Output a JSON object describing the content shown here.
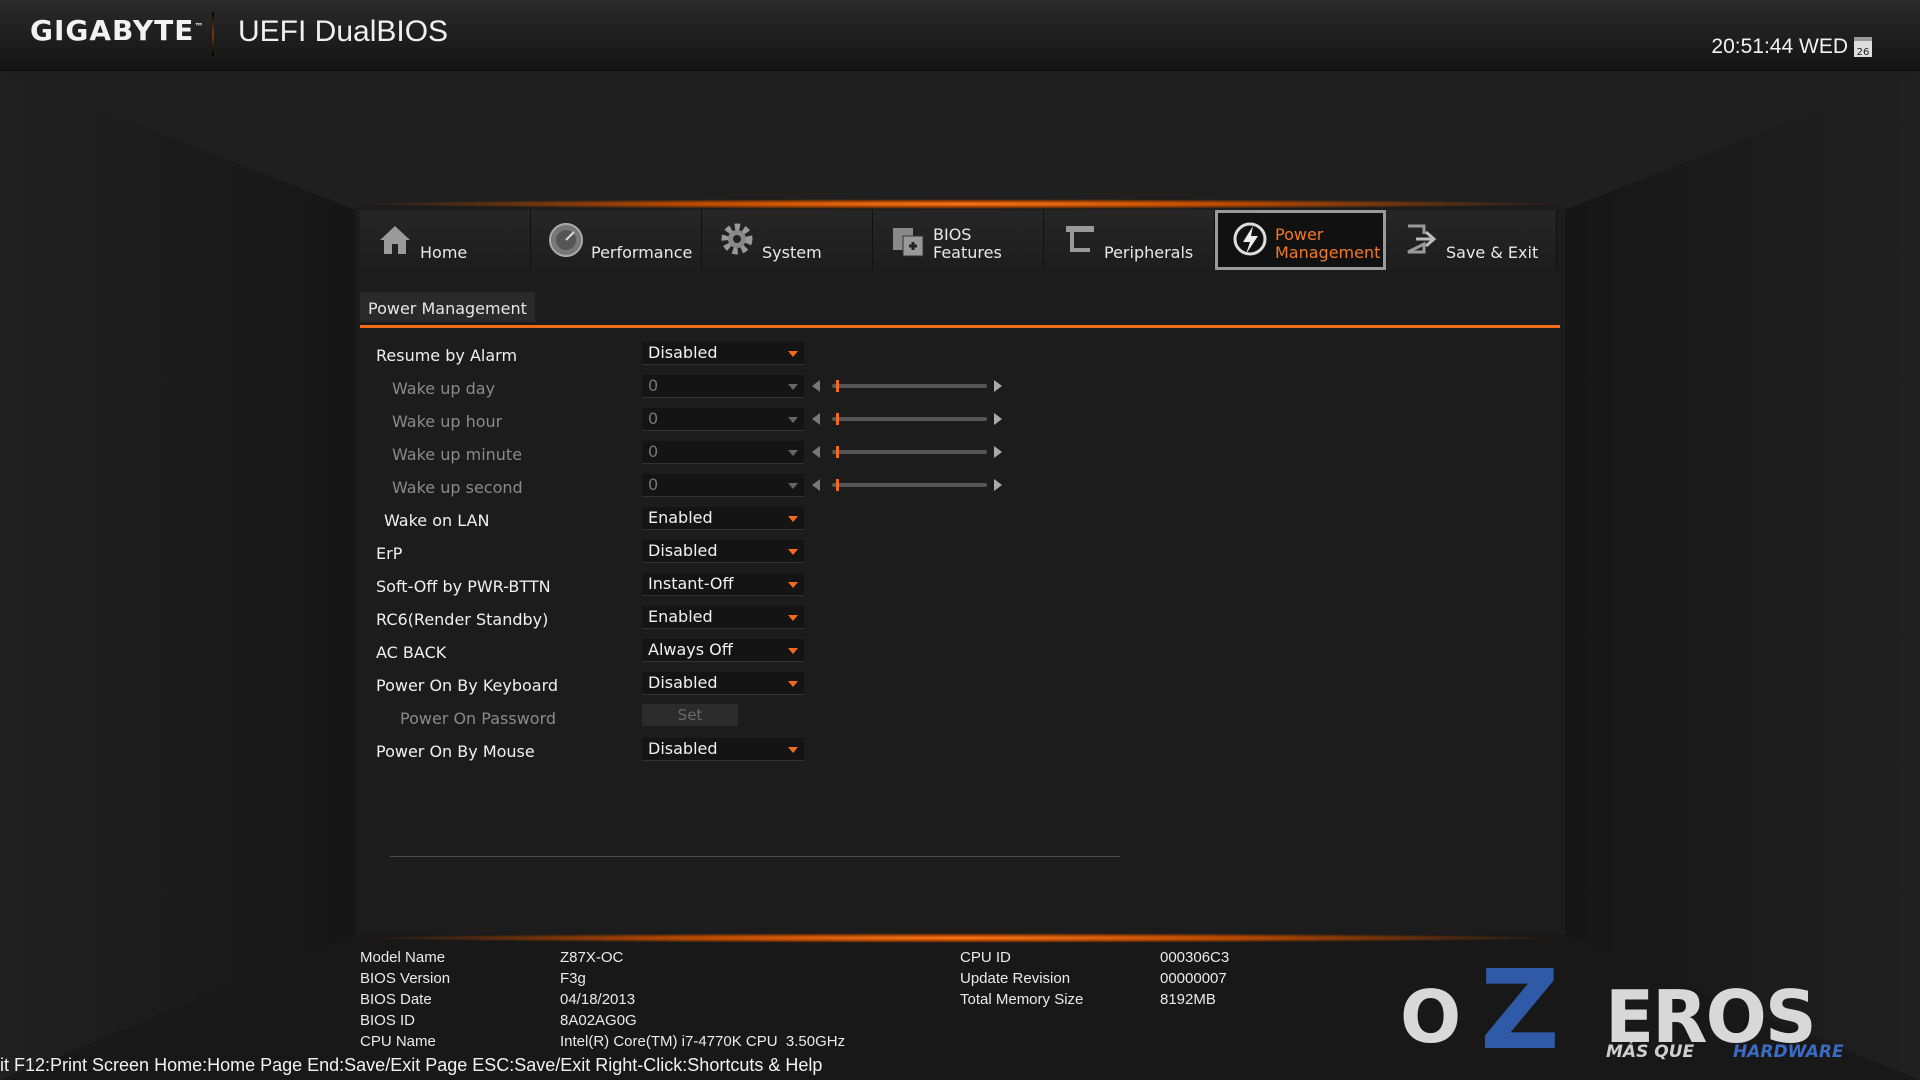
{
  "header": {
    "brand": "GIGABYTE",
    "brand_tm": "™",
    "title": "UEFI DualBIOS",
    "clock": "20:51:44 WED",
    "calendar_day": "26"
  },
  "tabs": [
    {
      "label": "Home",
      "icon": "home-icon"
    },
    {
      "label": "Performance",
      "icon": "speedometer-icon"
    },
    {
      "label": "System",
      "icon": "gear-icon"
    },
    {
      "label": "BIOS\nFeatures",
      "label_line1": "BIOS",
      "label_line2": "Features",
      "icon": "bios-chip-icon"
    },
    {
      "label": "Peripherals",
      "icon": "peripherals-icon"
    },
    {
      "label_line1": "Power",
      "label_line2": "Management",
      "icon": "power-icon",
      "active": true
    },
    {
      "label": "Save & Exit",
      "icon": "exit-icon"
    }
  ],
  "section": {
    "title": "Power Management"
  },
  "settings": [
    {
      "label": "Resume by Alarm",
      "value": "Disabled",
      "dim": false
    },
    {
      "label": "Wake up day",
      "value": "0",
      "dim": true
    },
    {
      "label": "Wake up hour",
      "value": "0",
      "dim": true
    },
    {
      "label": "Wake up minute",
      "value": "0",
      "dim": true
    },
    {
      "label": "Wake up second",
      "value": "0",
      "dim": true
    },
    {
      "label": "Wake on LAN",
      "value": "Enabled",
      "dim": false
    },
    {
      "label": "ErP",
      "value": "Disabled",
      "dim": false
    },
    {
      "label": "Soft-Off by PWR-BTTN",
      "value": "Instant-Off",
      "dim": false
    },
    {
      "label": "RC6(Render Standby)",
      "value": "Enabled",
      "dim": false
    },
    {
      "label": "AC BACK",
      "value": "Always Off",
      "dim": false
    },
    {
      "label": "Power On By Keyboard",
      "value": "Disabled",
      "dim": false
    },
    {
      "label": "Power On Password",
      "button": "Set",
      "dim": true
    },
    {
      "label": "Power On By Mouse",
      "value": "Disabled",
      "dim": false
    }
  ],
  "system_info": {
    "left": [
      {
        "key": "Model Name",
        "value": "Z87X-OC"
      },
      {
        "key": "BIOS Version",
        "value": "F3g"
      },
      {
        "key": "BIOS Date",
        "value": "04/18/2013"
      },
      {
        "key": "BIOS ID",
        "value": "8A02AG0G"
      },
      {
        "key": "CPU Name",
        "value": "Intel(R) Core(TM) i7-4770K CPU  3.50GHz"
      }
    ],
    "right": [
      {
        "key": "CPU ID",
        "value": "000306C3"
      },
      {
        "key": "Update Revision",
        "value": "00000007"
      },
      {
        "key": "Total Memory Size",
        "value": "8192MB"
      }
    ]
  },
  "hotkeys": "it F12:Print Screen Home:Home Page End:Save/Exit Page ESC:Save/Exit Right-Click:Shortcuts & Help",
  "watermark": {
    "o": "O",
    "z": "Z",
    "eros": "EROS",
    "tag1": "MÁS QUE",
    "tag2": "HARDWARE"
  },
  "colors": {
    "accent": "#f26b1d",
    "tab_active_border": "#9a9a9a",
    "watermark_blue": "#2f5aa8"
  }
}
